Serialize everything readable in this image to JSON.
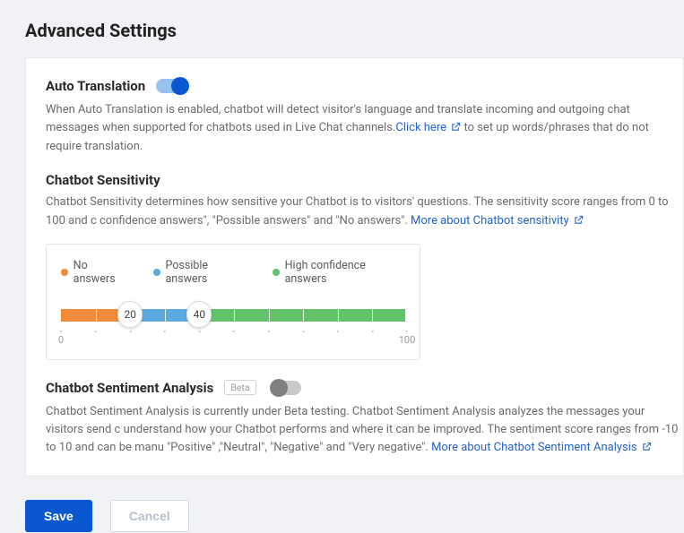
{
  "page": {
    "title": "Advanced Settings"
  },
  "auto_translation": {
    "title": "Auto Translation",
    "enabled": true,
    "desc_part1": "When Auto Translation is enabled, chatbot will detect visitor's language and translate incoming and outgoing chat messages when supported for chatbots used in Live Chat channels.",
    "link_text": "Click here",
    "desc_part2": " to set up words/phrases that do not require translation."
  },
  "sensitivity": {
    "title": "Chatbot Sensitivity",
    "desc": "Chatbot Sensitivity determines how sensitive your Chatbot is to visitors' questions. The sensitivity score ranges from 0 to 100 and c confidence answers\", \"Possible answers\" and \"No answers\". ",
    "link_text": "More about Chatbot sensitivity",
    "legend": {
      "no": "No answers",
      "possible": "Possible answers",
      "high": "High confidence answers"
    },
    "slider": {
      "min": 0,
      "max": 100,
      "low": 20,
      "high": 40
    },
    "colors": {
      "no": "#f08b3c",
      "possible": "#5aaae0",
      "high": "#63c36a"
    }
  },
  "sentiment": {
    "title": "Chatbot Sentiment Analysis",
    "badge": "Beta",
    "enabled": false,
    "desc": "Chatbot Sentiment Analysis is currently under Beta testing. Chatbot Sentiment Analysis analyzes the messages your visitors send c understand how your Chatbot performs and where it can be improved. The sentiment score ranges from -10 to 10 and can be manu \"Positive\" ,\"Neutral\", \"Negative\" and \"Very negative\". ",
    "link_text": "More about Chatbot Sentiment Analysis"
  },
  "buttons": {
    "save": "Save",
    "cancel": "Cancel"
  }
}
